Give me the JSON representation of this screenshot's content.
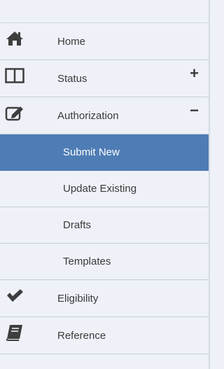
{
  "nav": {
    "items": [
      {
        "label": "Home",
        "icon": "home-icon"
      },
      {
        "label": "Status",
        "icon": "columns-icon",
        "toggle": "+"
      },
      {
        "label": "Authorization",
        "icon": "edit-icon",
        "toggle": "−"
      },
      {
        "label": "Eligibility",
        "icon": "check-icon"
      },
      {
        "label": "Reference",
        "icon": "book-icon"
      }
    ],
    "subitems": [
      {
        "label": "Submit New",
        "active": true
      },
      {
        "label": "Update Existing"
      },
      {
        "label": "Drafts"
      },
      {
        "label": "Templates"
      }
    ]
  },
  "colors": {
    "background": "#eef1f8",
    "active": "#4e7cb4",
    "text": "#3a3a3a",
    "icon": "#3e3e3e"
  }
}
